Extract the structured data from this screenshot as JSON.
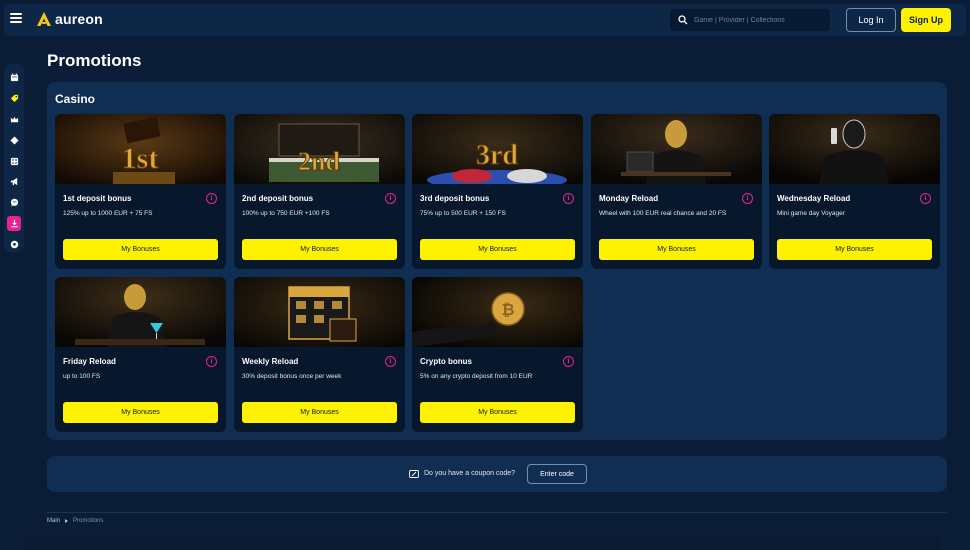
{
  "header": {
    "brand": "aureon",
    "search_placeholder": "Game | Provider | Collections",
    "login_label": "Log In",
    "signup_label": "Sign Up"
  },
  "sidebar": {
    "icons": [
      "calendar-icon",
      "tag-icon",
      "crown-icon",
      "diamond-icon",
      "dice-icon",
      "megaphone-icon",
      "chat-icon",
      "download-icon",
      "soccer-ball-icon"
    ],
    "active_index": 7
  },
  "page": {
    "title": "Promotions"
  },
  "casino": {
    "title": "Casino",
    "cards": [
      {
        "title": "1st deposit bonus",
        "desc": "125% up to 1000 EUR + 75 FS",
        "button": "My Bonuses",
        "art": "1st"
      },
      {
        "title": "2nd deposit bonus",
        "desc": "100% up to 750 EUR +100 FS",
        "button": "My Bonuses",
        "art": "2nd"
      },
      {
        "title": "3rd deposit bonus",
        "desc": "75% up to 500 EUR + 150 FS",
        "button": "My Bonuses",
        "art": "3rd"
      },
      {
        "title": "Monday Reload",
        "desc": "Wheel with 100 EUR real chance and 20 FS",
        "button": "My Bonuses",
        "art": ""
      },
      {
        "title": "Wednesday Reload",
        "desc": "Mini game day Voyager",
        "button": "My Bonuses",
        "art": ""
      },
      {
        "title": "Friday Reload",
        "desc": "up to 100 FS",
        "button": "My Bonuses",
        "art": ""
      },
      {
        "title": "Weekly Reload",
        "desc": "30% deposit bonus once per week",
        "button": "My Bonuses",
        "art": ""
      },
      {
        "title": "Crypto bonus",
        "desc": "5% on any crypto deposit from 10 EUR",
        "button": "My Bonuses",
        "art": ""
      }
    ]
  },
  "coupon": {
    "text": "Do you have a coupon code?",
    "button": "Enter code"
  },
  "breadcrumb": {
    "home": "Main",
    "current": "Promotions"
  },
  "colors": {
    "accent": "#fff200",
    "pink": "#e9228d",
    "background": "#0b1d36",
    "panel": "#102d52"
  }
}
